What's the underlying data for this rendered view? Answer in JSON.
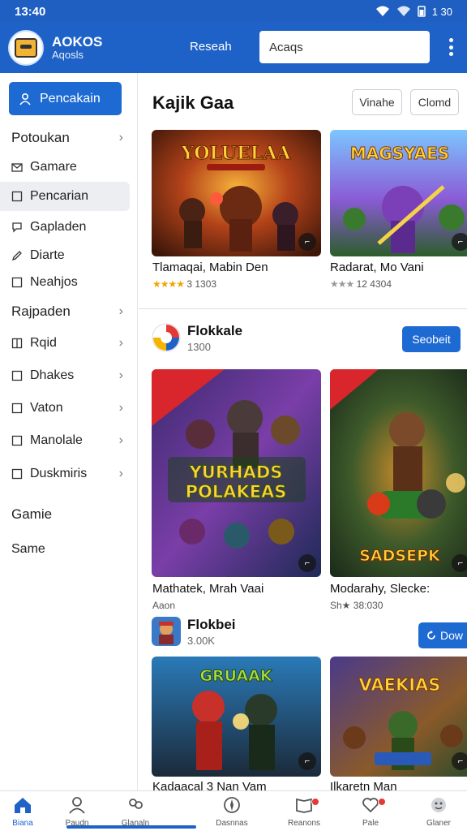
{
  "status_bar": {
    "time": "13:40",
    "battery": "1 30"
  },
  "header": {
    "app_title": "AOKOS",
    "app_subtitle": "Aqosls",
    "research_label": "Reseah",
    "search_value": "Acaqs"
  },
  "sidebar": {
    "primary_button": "Pencakain",
    "items": [
      {
        "label": "Potoukan",
        "icon": "none",
        "chevron": true,
        "header": true
      },
      {
        "label": "Gamare",
        "icon": "mail-icon",
        "chevron": false
      },
      {
        "label": "Pencarian",
        "icon": "square-icon",
        "chevron": false,
        "active": true
      },
      {
        "label": "Gapladen",
        "icon": "chat-icon",
        "chevron": false
      },
      {
        "label": "Diarte",
        "icon": "pencil-icon",
        "chevron": false
      },
      {
        "label": "Neahjos",
        "icon": "square-icon",
        "chevron": false
      },
      {
        "label": "Rajpaden",
        "icon": "none",
        "chevron": true,
        "header": true
      },
      {
        "label": "Rqid",
        "icon": "book-icon",
        "chevron": true
      },
      {
        "label": "Dhakes",
        "icon": "square-icon",
        "chevron": true
      },
      {
        "label": "Vaton",
        "icon": "square-icon",
        "chevron": true
      },
      {
        "label": "Manolale",
        "icon": "square-icon",
        "chevron": true
      },
      {
        "label": "Duskmiris",
        "icon": "square-icon",
        "chevron": true
      },
      {
        "label": "Gamie",
        "icon": "none",
        "chevron": false,
        "header": true
      },
      {
        "label": "Same",
        "icon": "none",
        "chevron": false
      }
    ]
  },
  "main": {
    "section_title": "Kajik Gaa",
    "chip_1": "Vinahe",
    "chip_2": "Clomd",
    "row1": [
      {
        "art_title": "YOLUELAA",
        "title": "Tlamaqai, Mabin Den",
        "stars": "★★★★",
        "meta": "3 1303",
        "star_color": "gold"
      },
      {
        "art_title": "MAGSYAES",
        "title": "Radarat, Mo Vani",
        "stars": "★★★",
        "meta": "12 4304",
        "star_color": "grey"
      }
    ],
    "publisher_1": {
      "name": "Flokkale",
      "count": "1300",
      "button": "Seobeit"
    },
    "row2": [
      {
        "art_title": "YURHADS POLAKEAS",
        "title": "Mathatek, Mrah Vaai",
        "stars": "",
        "meta": "Aaon"
      },
      {
        "art_title": "SADSEPK",
        "title": "Modarahy, Slecke:",
        "stars": "",
        "meta": "Sh★ 38:030"
      }
    ],
    "publisher_2": {
      "name": "Flokbei",
      "count": "3.00K",
      "button": "Dow"
    },
    "row3": [
      {
        "art_title": "GRUAAK",
        "title": "Kadaacal 3 Nan Vam",
        "meta": ""
      },
      {
        "art_title": "VAEKIAS",
        "title": "Ilkaretn Man",
        "meta": ""
      }
    ]
  },
  "bottom_nav": [
    {
      "label": "Biana",
      "icon": "home-icon",
      "active": true,
      "badge": false
    },
    {
      "label": "Paudn",
      "icon": "person-icon",
      "active": false,
      "badge": false
    },
    {
      "label": "Glanaln",
      "icon": "groups-icon",
      "active": false,
      "badge": false
    },
    {
      "label": "Dasnnas",
      "icon": "compass-icon",
      "active": false,
      "badge": false
    },
    {
      "label": "Reanons",
      "icon": "news-icon",
      "active": false,
      "badge": true
    },
    {
      "label": "Pale",
      "icon": "heart-icon",
      "active": false,
      "badge": true
    },
    {
      "label": "Glaner",
      "icon": "face-icon",
      "active": false,
      "badge": false
    }
  ],
  "colors": {
    "brand_blue": "#1e62c8",
    "accent_green": "#4caf2e",
    "badge_red": "#e53935"
  }
}
